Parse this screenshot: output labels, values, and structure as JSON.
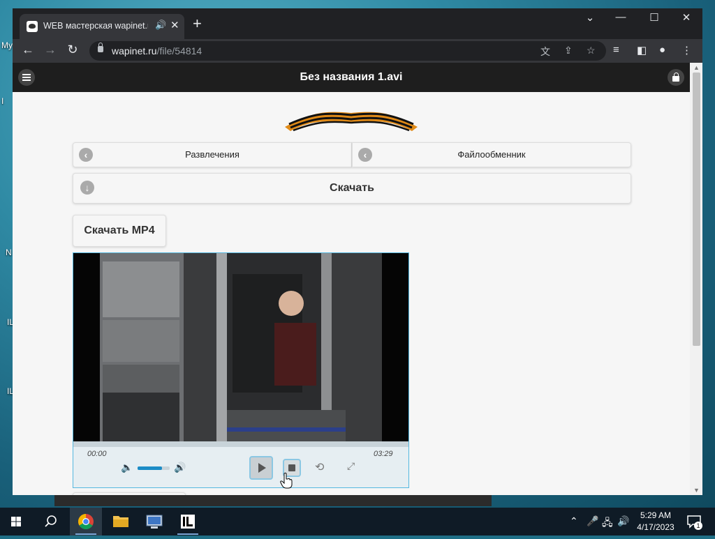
{
  "desktop": {
    "icon_labels": [
      "My",
      "I",
      "N",
      "IL",
      "IL"
    ]
  },
  "browser": {
    "tab_title": "WEB мастерская wapinet.ru",
    "url_domain": "wapinet.ru",
    "url_path": "/file/54814"
  },
  "site": {
    "title": "Без названия 1.avi",
    "nav_left": "Развлечения",
    "nav_right": "Файлообменник",
    "download": "Скачать",
    "download_mp4": "Скачать MP4"
  },
  "player": {
    "time_current": "00:00",
    "time_total": "03:29",
    "volume": 0.75,
    "progress": 0.0
  },
  "taskbar": {
    "time": "5:29 AM",
    "date": "4/17/2023",
    "notification_count": "1"
  },
  "colors": {
    "chrome_dark": "#202124",
    "site_header": "#1e1e1e",
    "accent_blue": "#1c8cc6",
    "taskbar": "#0f1b26"
  }
}
